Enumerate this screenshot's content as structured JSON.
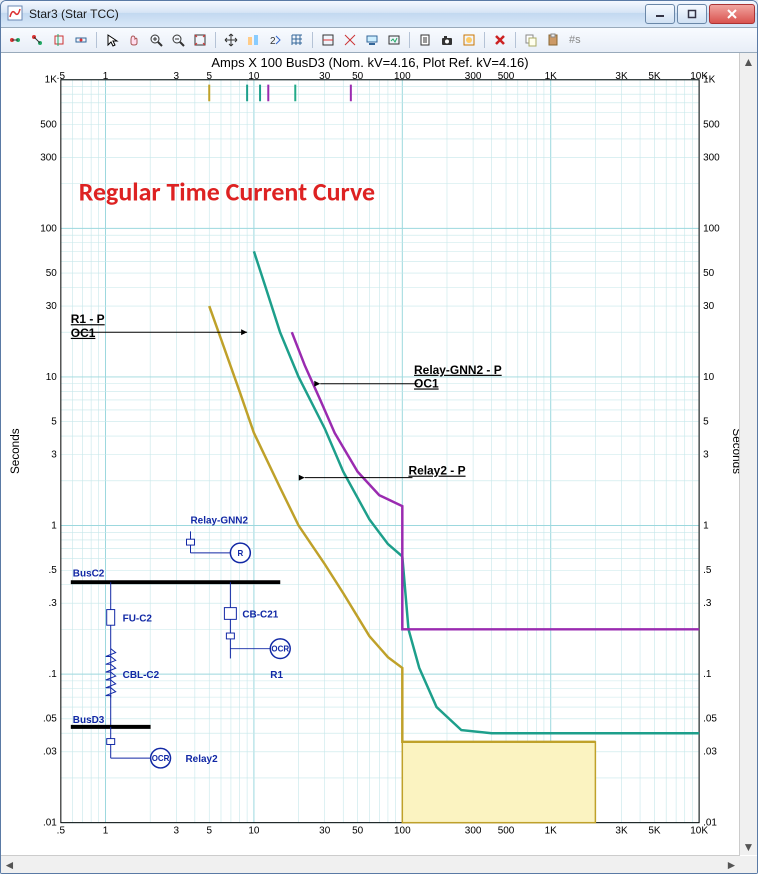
{
  "window": {
    "title": "Star3 (Star TCC)"
  },
  "toolbar": {
    "readout": "#s"
  },
  "plot": {
    "header": "Amps  X  100   BusD3 (Nom. kV=4.16, Plot Ref. kV=4.16)",
    "y_label_left": "Seconds",
    "y_label_right": "Seconds",
    "x_ticks": [
      ".5",
      "1",
      "3",
      "5",
      "10",
      "30",
      "50",
      "100",
      "300",
      "500",
      "1K",
      "3K",
      "5K",
      "10K"
    ],
    "y_ticks": [
      ".01",
      ".03",
      ".05",
      ".1",
      ".3",
      ".5",
      "1",
      "3",
      "5",
      "10",
      "30",
      "50",
      "100",
      "300",
      "500",
      "1K"
    ],
    "overlay_title": "Regular Time Current Curve",
    "curve_labels": {
      "r1p": "R1 - P",
      "r1p_sub": "OC1",
      "relay_gnn2": "Relay-GNN2 - P",
      "relay_gnn2_sub": "OC1",
      "relay2": "Relay2 - P"
    },
    "mini_diagram": {
      "relay_gnn2": "Relay-GNN2",
      "r_symbol": "R",
      "busC2": "BusC2",
      "fu_c2": "FU-C2",
      "cb_c21": "CB-C21",
      "ocr1": "OCR",
      "r1": "R1",
      "cbl_c2": "CBL-C2",
      "busD3": "BusD3",
      "ocr2": "OCR",
      "relay2": "Relay2"
    }
  },
  "colors": {
    "grid_fine": "#c6e7ea",
    "grid_coarse": "#9cd8de",
    "curve_olive": "#bfa12a",
    "curve_teal": "#1d9f8b",
    "curve_purple": "#9a2bb0",
    "box_fill": "#fbf3c1",
    "box_stroke": "#bfa12a"
  },
  "chart_data": {
    "type": "line",
    "xscale": "log",
    "yscale": "log",
    "xlabel": "Amps × 100",
    "ylabel": "Seconds",
    "xlim": [
      0.5,
      10000
    ],
    "ylim": [
      0.01,
      1000
    ],
    "x_ticks": [
      0.5,
      1,
      3,
      5,
      10,
      30,
      50,
      100,
      300,
      500,
      1000,
      3000,
      5000,
      10000
    ],
    "y_ticks": [
      0.01,
      0.03,
      0.05,
      0.1,
      0.3,
      0.5,
      1,
      3,
      5,
      10,
      30,
      50,
      100,
      300,
      500,
      1000
    ],
    "series": [
      {
        "name": "R1 - P  OC1",
        "color": "#bfa12a",
        "points": [
          {
            "x": 5,
            "y": 30
          },
          {
            "x": 6,
            "y": 18
          },
          {
            "x": 8,
            "y": 8
          },
          {
            "x": 10,
            "y": 4.2
          },
          {
            "x": 15,
            "y": 1.8
          },
          {
            "x": 20,
            "y": 1.0
          },
          {
            "x": 30,
            "y": 0.55
          },
          {
            "x": 40,
            "y": 0.35
          },
          {
            "x": 60,
            "y": 0.18
          },
          {
            "x": 80,
            "y": 0.13
          },
          {
            "x": 100,
            "y": 0.11
          },
          {
            "x": 100,
            "y": 0.035
          },
          {
            "x": 2000,
            "y": 0.035
          }
        ]
      },
      {
        "name": "Relay2 - P",
        "color": "#1d9f8b",
        "points": [
          {
            "x": 10,
            "y": 70
          },
          {
            "x": 12,
            "y": 40
          },
          {
            "x": 15,
            "y": 20
          },
          {
            "x": 20,
            "y": 10
          },
          {
            "x": 30,
            "y": 4.5
          },
          {
            "x": 40,
            "y": 2.3
          },
          {
            "x": 60,
            "y": 1.1
          },
          {
            "x": 80,
            "y": 0.75
          },
          {
            "x": 100,
            "y": 0.62
          },
          {
            "x": 110,
            "y": 0.2
          },
          {
            "x": 130,
            "y": 0.11
          },
          {
            "x": 170,
            "y": 0.06
          },
          {
            "x": 250,
            "y": 0.042
          },
          {
            "x": 400,
            "y": 0.04
          },
          {
            "x": 10000,
            "y": 0.04
          }
        ]
      },
      {
        "name": "Relay-GNN2 - P  OC1",
        "color": "#9a2bb0",
        "points": [
          {
            "x": 18,
            "y": 20
          },
          {
            "x": 22,
            "y": 12
          },
          {
            "x": 28,
            "y": 7
          },
          {
            "x": 35,
            "y": 4.2
          },
          {
            "x": 50,
            "y": 2.3
          },
          {
            "x": 70,
            "y": 1.6
          },
          {
            "x": 100,
            "y": 1.35
          },
          {
            "x": 100,
            "y": 0.2
          },
          {
            "x": 10000,
            "y": 0.2
          }
        ]
      }
    ],
    "annotations": [
      {
        "type": "rect",
        "name": "shaded-region",
        "x0": 100,
        "x1": 2000,
        "y0": 0.01,
        "y1": 0.035,
        "fill": "#fbf3c1",
        "stroke": "#bfa12a"
      }
    ]
  }
}
